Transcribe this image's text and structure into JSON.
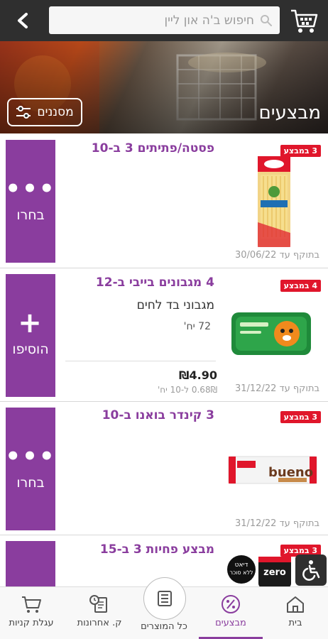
{
  "search": {
    "placeholder": "חיפוש ב'ה און ליין"
  },
  "banner": {
    "title": "מבצעים",
    "filter_label": "מסננים"
  },
  "deals": [
    {
      "title": "פסטה/פתיתים 3 ב-10",
      "badge": "3 במבצע",
      "action_symbol": "•••",
      "action_label": "בחרו",
      "valid": "בתוקף עד 30/06/22"
    },
    {
      "title": "4 מגבונים בייבי ב-12",
      "badge": "4 במבצע",
      "action_symbol": "+",
      "action_label": "הוסיפו",
      "product_name": "מגבוני בד לחים",
      "unit_count": "72 יח'",
      "price": "₪4.90",
      "unit_price": "0.68₪ ל-10 יח'",
      "valid": "בתוקף עד 31/12/22"
    },
    {
      "title": "3 קינדר בואנו ב-10",
      "badge": "3 במבצע",
      "action_symbol": "•••",
      "action_label": "בחרו",
      "valid": "בתוקף עד 31/12/22",
      "product_brand": "bueno"
    },
    {
      "title": "מבצע פחיות 3 ב-15",
      "badge": "3 במבצע",
      "product_brand": "zero",
      "sticker_text": "דיאט ללא סוכר"
    }
  ],
  "bottom_nav": [
    {
      "label": "בית",
      "icon": "home-icon"
    },
    {
      "label": "מבצעים",
      "icon": "percent-icon",
      "active": true
    },
    {
      "label": "כל המוצרים",
      "icon": "list-icon"
    },
    {
      "label": "ק. אחרונות",
      "icon": "receipt-icon"
    },
    {
      "label": "עגלת קניות",
      "icon": "cart-icon"
    }
  ],
  "colors": {
    "accent": "#8a3d9e",
    "badge": "#e0162b",
    "topbar": "#2f2f2f"
  }
}
